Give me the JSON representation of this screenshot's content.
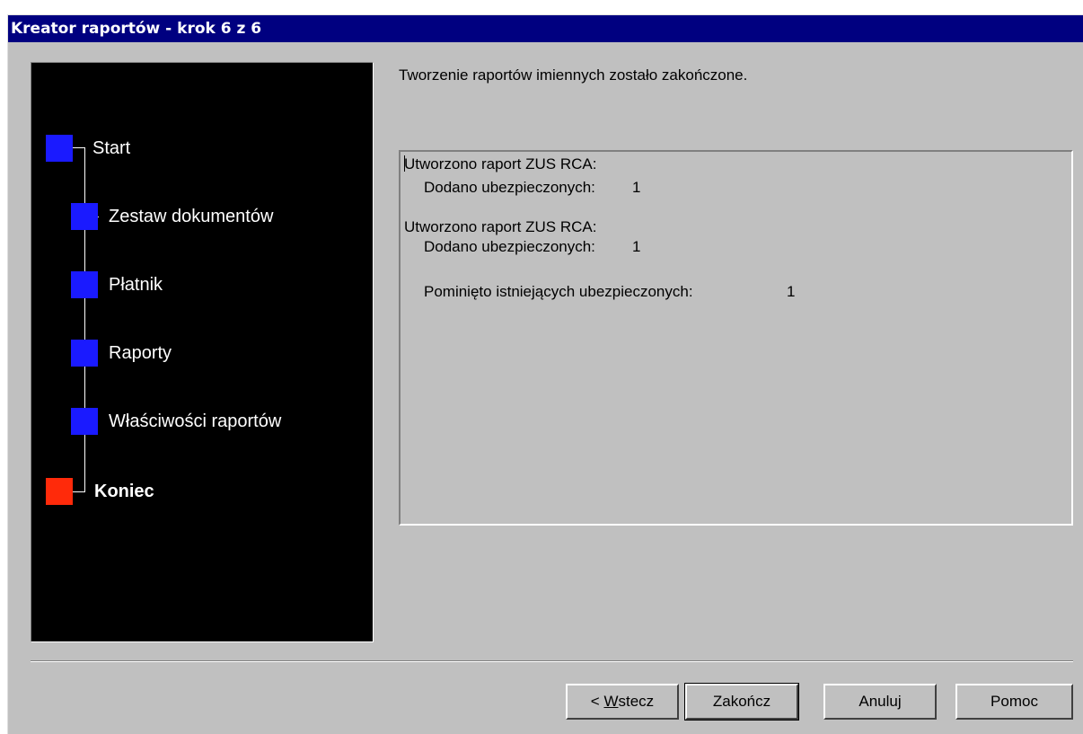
{
  "window": {
    "title": "Kreator raportów - krok 6 z 6"
  },
  "steps": [
    {
      "label": "Start",
      "state": "done",
      "color": "#1a1aff"
    },
    {
      "label": "Zestaw dokumentów",
      "state": "done",
      "color": "#1a1aff"
    },
    {
      "label": "Płatnik",
      "state": "done",
      "color": "#1a1aff"
    },
    {
      "label": "Raporty",
      "state": "done",
      "color": "#1a1aff"
    },
    {
      "label": "Właściwości raportów",
      "state": "done",
      "color": "#1a1aff"
    },
    {
      "label": "Koniec",
      "state": "current",
      "color": "#ff2a0a"
    }
  ],
  "main": {
    "message": "Tworzenie raportów imiennych zostało zakończone.",
    "log": {
      "entry1_title": "Utworzono raport ZUS RCA:",
      "entry1_added_label": "Dodano ubezpieczonych:",
      "entry1_added_value": "1",
      "entry2_title": "Utworzono raport ZUS RCA:",
      "entry2_added_label": "Dodano ubezpieczonych:",
      "entry2_added_value": "1",
      "skipped_label": "Pominięto istniejących ubezpieczonych:",
      "skipped_value": "1"
    }
  },
  "buttons": {
    "back_prefix": "< ",
    "back_accel": "W",
    "back_rest": "stecz",
    "finish": "Zakończ",
    "cancel": "Anuluj",
    "help": "Pomoc"
  }
}
